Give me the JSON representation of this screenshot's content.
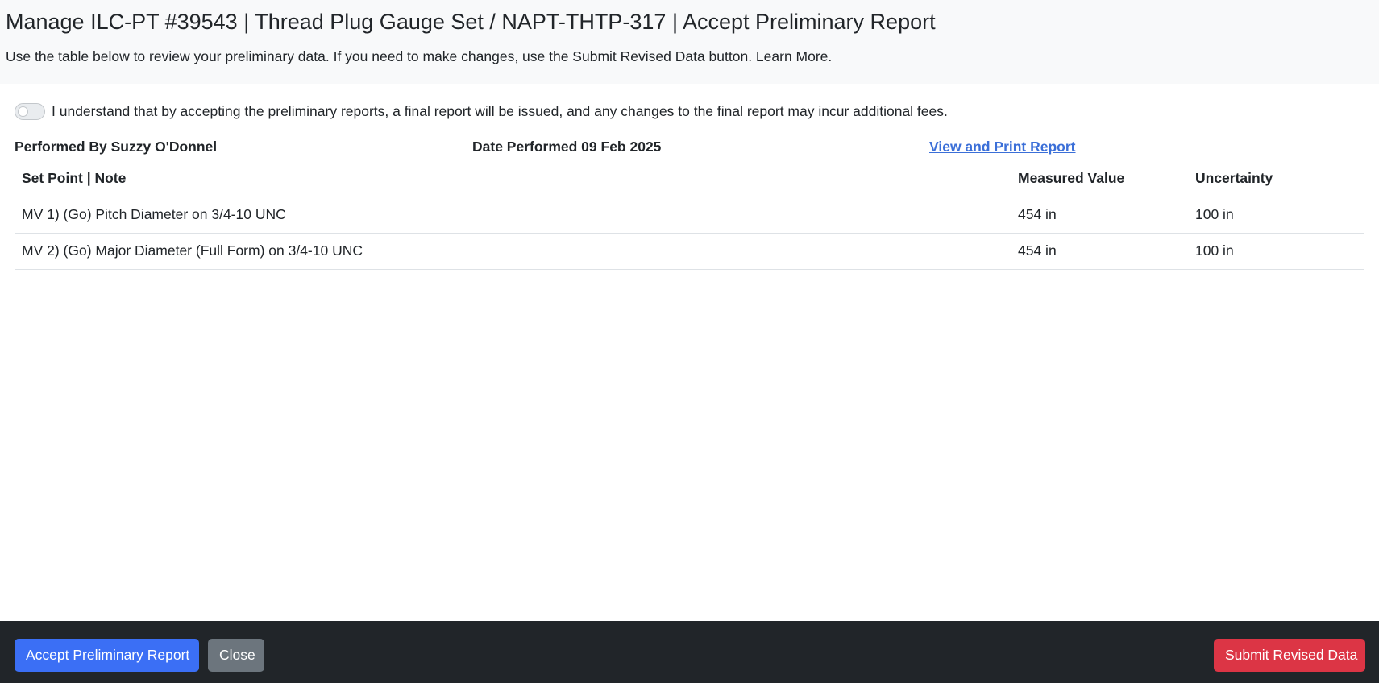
{
  "header": {
    "title": "Manage ILC-PT #39543 | Thread Plug Gauge Set / NAPT-THTP-317 | Accept Preliminary Report",
    "subtitle": "Use the table below to review your preliminary data. If you need to make changes, use the Submit Revised Data button. Learn More."
  },
  "acknowledgement": {
    "checked": false,
    "text": "I understand that by accepting the preliminary reports, a final report will be issued, and any changes to the final report may incur additional fees."
  },
  "meta": {
    "performed_by": "Performed By Suzzy O'Donnel",
    "date_performed": "Date Performed 09 Feb 2025",
    "report_link": "View and Print Report"
  },
  "table": {
    "headers": [
      "Set Point | Note",
      "Measured Value",
      "Uncertainty"
    ],
    "rows": [
      [
        "MV 1) (Go) Pitch Diameter on 3/4-10 UNC",
        "454 in",
        "100 in"
      ],
      [
        "MV 2) (Go) Major Diameter (Full Form) on 3/4-10 UNC",
        "454 in",
        "100 in"
      ]
    ]
  },
  "footer": {
    "accept_label": "Accept Preliminary Report",
    "close_label": "Close",
    "submit_label": "Submit Revised Data"
  },
  "colors": {
    "primary": "#3b6ff5",
    "secondary": "#6c757d",
    "danger": "#dc3545",
    "footer_bg": "#212529",
    "link": "#3b6fd8"
  }
}
